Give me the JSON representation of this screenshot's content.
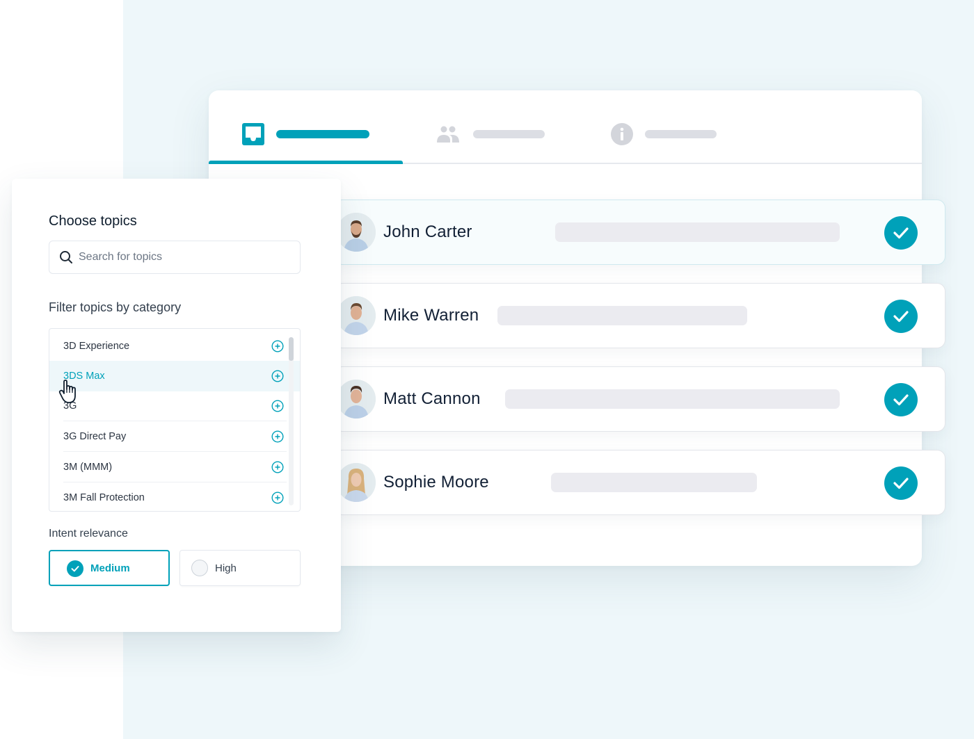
{
  "colors": {
    "accent": "#00a1b9",
    "muted_bar": "#dcdee4",
    "placeholder_bar": "#ebebf0",
    "background_tint": "#eef7fa"
  },
  "main_panel": {
    "tabs": [
      {
        "icon": "inbox-icon",
        "active": true
      },
      {
        "icon": "users-icon",
        "active": false
      },
      {
        "icon": "info-icon",
        "active": false
      }
    ],
    "people": [
      {
        "name": "John Carter",
        "avatar": "avatar-john-carter",
        "checked": true,
        "highlighted": true
      },
      {
        "name": "Mike Warren",
        "avatar": "avatar-mike-warren",
        "checked": true,
        "highlighted": false
      },
      {
        "name": "Matt Cannon",
        "avatar": "avatar-matt-cannon",
        "checked": true,
        "highlighted": false
      },
      {
        "name": "Sophie Moore",
        "avatar": "avatar-sophie-moore",
        "checked": true,
        "highlighted": false
      }
    ]
  },
  "topic_panel": {
    "title": "Choose topics",
    "search": {
      "placeholder": "Search for topics",
      "value": "",
      "icon": "search-icon"
    },
    "filter_label": "Filter topics by category",
    "topics": [
      {
        "label": "3D Experience",
        "hovered": false
      },
      {
        "label": "3DS Max",
        "hovered": true
      },
      {
        "label": "3G",
        "hovered": false
      },
      {
        "label": "3G Direct Pay",
        "hovered": false
      },
      {
        "label": "3M (MMM)",
        "hovered": false
      },
      {
        "label": "3M Fall Protection",
        "hovered": false
      }
    ],
    "intent_label": "Intent relevance",
    "intent_options": [
      {
        "label": "Medium",
        "selected": true
      },
      {
        "label": "High",
        "selected": false
      }
    ]
  }
}
